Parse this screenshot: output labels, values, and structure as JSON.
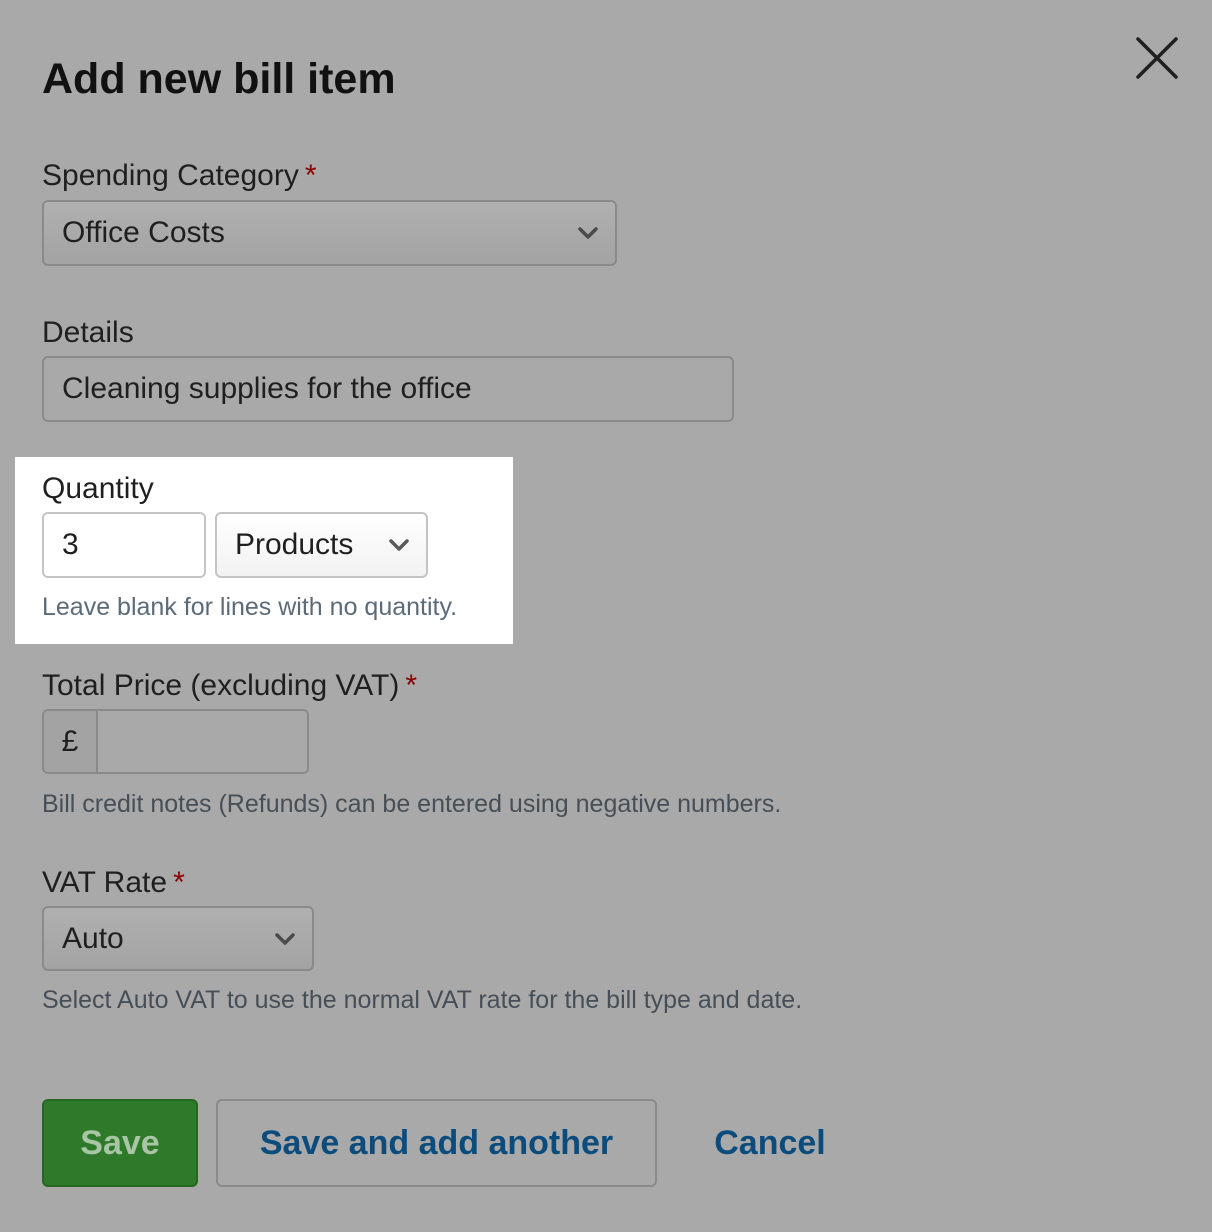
{
  "dialog": {
    "title": "Add new bill item",
    "close_icon": "close-icon"
  },
  "spending_category": {
    "label": "Spending Category",
    "required_mark": "*",
    "value": "Office Costs",
    "icon": "chevron-down-icon"
  },
  "details": {
    "label": "Details",
    "value": "Cleaning supplies for the office"
  },
  "quantity": {
    "label": "Quantity",
    "value": "3",
    "unit_value": "Products",
    "hint": "Leave blank for lines with no quantity."
  },
  "total_price": {
    "label": "Total Price (excluding VAT)",
    "required_mark": "*",
    "currency_symbol": "£",
    "value": "",
    "hint": "Bill credit notes (Refunds) can be entered using negative numbers."
  },
  "vat_rate": {
    "label": "VAT Rate",
    "required_mark": "*",
    "value": "Auto",
    "hint": "Select Auto VAT to use the normal VAT rate for the bill type and date."
  },
  "actions": {
    "save_label": "Save",
    "save_add_label": "Save and add another",
    "cancel_label": "Cancel"
  },
  "colors": {
    "overlay": "#a9a9a9",
    "highlight": "#ffffff",
    "save_button": "#2f7a2a",
    "link": "#0c4c7c",
    "required": "#8b0000"
  }
}
